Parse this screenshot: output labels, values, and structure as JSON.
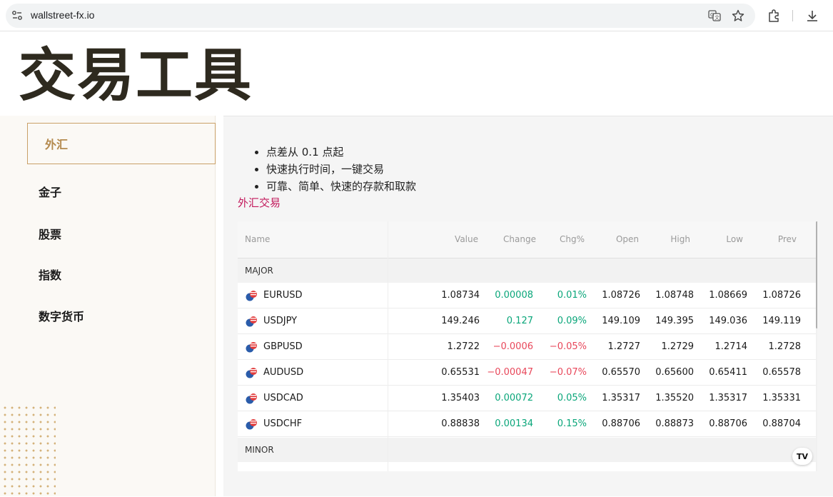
{
  "browser": {
    "url": "wallstreet-fx.io"
  },
  "page": {
    "title": "交易工具"
  },
  "sidebar": {
    "items": [
      {
        "label": "外汇",
        "active": true
      },
      {
        "label": "金子"
      },
      {
        "label": "股票"
      },
      {
        "label": "指数"
      },
      {
        "label": "数字货币"
      }
    ]
  },
  "content": {
    "bullets": [
      "点差从 0.1 点起",
      "快速执行时间，一键交易",
      "可靠、简单、快速的存款和取款"
    ],
    "link_label": "外汇交易"
  },
  "widget": {
    "headers": {
      "name": "Name",
      "value": "Value",
      "change": "Change",
      "chg_pct": "Chg%",
      "open": "Open",
      "high": "High",
      "low": "Low",
      "prev": "Prev"
    },
    "groups": {
      "major": "MAJOR",
      "minor": "MINOR"
    },
    "rows": [
      {
        "symbol": "EURUSD",
        "value": "1.08734",
        "change": "0.00008",
        "chg_pct": "0.01%",
        "open": "1.08726",
        "high": "1.08748",
        "low": "1.08669",
        "prev": "1.08726",
        "direction": "up"
      },
      {
        "symbol": "USDJPY",
        "value": "149.246",
        "change": "0.127",
        "chg_pct": "0.09%",
        "open": "149.109",
        "high": "149.395",
        "low": "149.036",
        "prev": "149.119",
        "direction": "up"
      },
      {
        "symbol": "GBPUSD",
        "value": "1.2722",
        "change": "−0.0006",
        "chg_pct": "−0.05%",
        "open": "1.2727",
        "high": "1.2729",
        "low": "1.2714",
        "prev": "1.2728",
        "direction": "down"
      },
      {
        "symbol": "AUDUSD",
        "value": "0.65531",
        "change": "−0.00047",
        "chg_pct": "−0.07%",
        "open": "0.65570",
        "high": "0.65600",
        "low": "0.65411",
        "prev": "0.65578",
        "direction": "down"
      },
      {
        "symbol": "USDCAD",
        "value": "1.35403",
        "change": "0.00072",
        "chg_pct": "0.05%",
        "open": "1.35317",
        "high": "1.35520",
        "low": "1.35317",
        "prev": "1.35331",
        "direction": "up"
      },
      {
        "symbol": "USDCHF",
        "value": "0.88838",
        "change": "0.00134",
        "chg_pct": "0.15%",
        "open": "0.88706",
        "high": "0.88873",
        "low": "0.88706",
        "prev": "0.88704",
        "direction": "up"
      }
    ],
    "badge": "TV"
  },
  "colors": {
    "positive": "#0aa67a",
    "negative": "#e8475a",
    "accent_gold": "#c9a067",
    "link": "#c2185b"
  }
}
